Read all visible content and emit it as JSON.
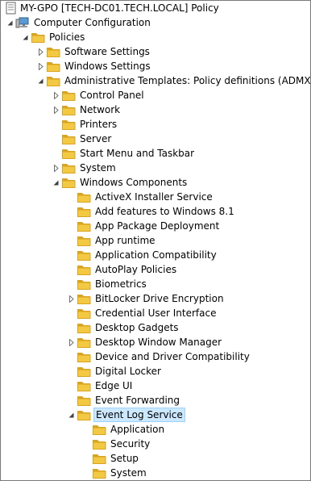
{
  "colors": {
    "folder": "#f3c843",
    "folder_dark": "#d9a520",
    "selection": "#cce8ff"
  },
  "tree": [
    {
      "label": "MY-GPO [TECH-DC01.TECH.LOCAL] Policy",
      "icon": "policy-document-icon",
      "level": 0,
      "expander": "none"
    },
    {
      "label": "Computer Configuration",
      "icon": "computer-icon",
      "level": 1,
      "expander": "expanded"
    },
    {
      "label": "Policies",
      "icon": "folder-icon",
      "level": 2,
      "expander": "expanded"
    },
    {
      "label": "Software Settings",
      "icon": "folder-icon",
      "level": 3,
      "expander": "collapsed"
    },
    {
      "label": "Windows Settings",
      "icon": "folder-icon",
      "level": 3,
      "expander": "collapsed"
    },
    {
      "label": "Administrative Templates: Policy definitions (ADMX files)",
      "icon": "folder-icon",
      "level": 3,
      "expander": "expanded"
    },
    {
      "label": "Control Panel",
      "icon": "folder-icon",
      "level": 4,
      "expander": "collapsed"
    },
    {
      "label": "Network",
      "icon": "folder-icon",
      "level": 4,
      "expander": "collapsed"
    },
    {
      "label": "Printers",
      "icon": "folder-icon",
      "level": 4,
      "expander": "none"
    },
    {
      "label": "Server",
      "icon": "folder-icon",
      "level": 4,
      "expander": "none"
    },
    {
      "label": "Start Menu and Taskbar",
      "icon": "folder-icon",
      "level": 4,
      "expander": "none"
    },
    {
      "label": "System",
      "icon": "folder-icon",
      "level": 4,
      "expander": "collapsed"
    },
    {
      "label": "Windows Components",
      "icon": "folder-icon",
      "level": 4,
      "expander": "expanded"
    },
    {
      "label": "ActiveX Installer Service",
      "icon": "folder-icon",
      "level": 5,
      "expander": "none"
    },
    {
      "label": "Add features to Windows 8.1",
      "icon": "folder-icon",
      "level": 5,
      "expander": "none"
    },
    {
      "label": "App Package Deployment",
      "icon": "folder-icon",
      "level": 5,
      "expander": "none"
    },
    {
      "label": "App runtime",
      "icon": "folder-icon",
      "level": 5,
      "expander": "none"
    },
    {
      "label": "Application Compatibility",
      "icon": "folder-icon",
      "level": 5,
      "expander": "none"
    },
    {
      "label": "AutoPlay Policies",
      "icon": "folder-icon",
      "level": 5,
      "expander": "none"
    },
    {
      "label": "Biometrics",
      "icon": "folder-icon",
      "level": 5,
      "expander": "none"
    },
    {
      "label": "BitLocker Drive Encryption",
      "icon": "folder-icon",
      "level": 5,
      "expander": "collapsed"
    },
    {
      "label": "Credential User Interface",
      "icon": "folder-icon",
      "level": 5,
      "expander": "none"
    },
    {
      "label": "Desktop Gadgets",
      "icon": "folder-icon",
      "level": 5,
      "expander": "none"
    },
    {
      "label": "Desktop Window Manager",
      "icon": "folder-icon",
      "level": 5,
      "expander": "collapsed"
    },
    {
      "label": "Device and Driver Compatibility",
      "icon": "folder-icon",
      "level": 5,
      "expander": "none"
    },
    {
      "label": "Digital Locker",
      "icon": "folder-icon",
      "level": 5,
      "expander": "none"
    },
    {
      "label": "Edge UI",
      "icon": "folder-icon",
      "level": 5,
      "expander": "none"
    },
    {
      "label": "Event Forwarding",
      "icon": "folder-icon",
      "level": 5,
      "expander": "none"
    },
    {
      "label": "Event Log Service",
      "icon": "folder-icon",
      "level": 5,
      "expander": "expanded",
      "selected": true
    },
    {
      "label": "Application",
      "icon": "folder-icon",
      "level": 6,
      "expander": "none"
    },
    {
      "label": "Security",
      "icon": "folder-icon",
      "level": 6,
      "expander": "none"
    },
    {
      "label": "Setup",
      "icon": "folder-icon",
      "level": 6,
      "expander": "none"
    },
    {
      "label": "System",
      "icon": "folder-icon",
      "level": 6,
      "expander": "none"
    }
  ]
}
